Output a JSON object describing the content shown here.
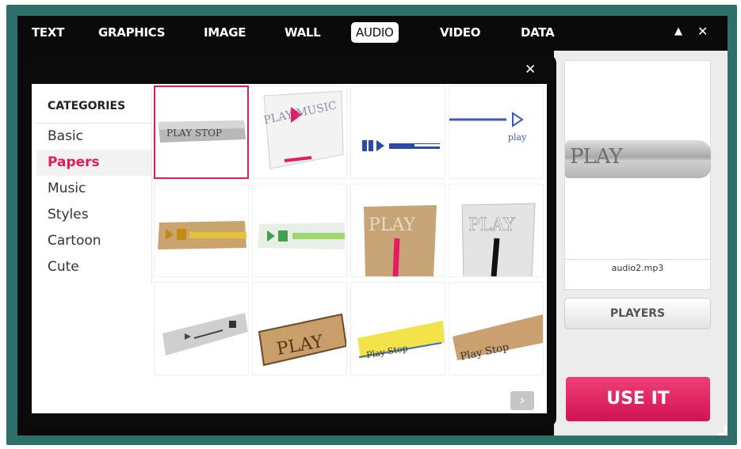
{
  "tabs": [
    {
      "label": "TEXT",
      "active": false
    },
    {
      "label": "GRAPHICS",
      "active": false
    },
    {
      "label": "IMAGE",
      "active": false
    },
    {
      "label": "WALL",
      "active": false
    },
    {
      "label": "AUDIO",
      "active": true
    },
    {
      "label": "VIDEO",
      "active": false
    },
    {
      "label": "DATA",
      "active": false
    }
  ],
  "window_controls": {
    "collapse": "▲",
    "close": "✕"
  },
  "dialog": {
    "close": "✕"
  },
  "categories": {
    "header": "CATEGORIES",
    "items": [
      {
        "label": "Basic",
        "active": false
      },
      {
        "label": "Papers",
        "active": true
      },
      {
        "label": "Music",
        "active": false
      },
      {
        "label": "Styles",
        "active": false
      },
      {
        "label": "Cartoon",
        "active": false
      },
      {
        "label": "Cute",
        "active": false
      }
    ]
  },
  "players_grid": {
    "tiles": [
      {
        "label": "PLAY STOP",
        "selected": true
      },
      {
        "label": "PLAY MUSIC",
        "selected": false
      },
      {
        "label": "",
        "selected": false
      },
      {
        "label": "play",
        "selected": false
      },
      {
        "label": "",
        "selected": false
      },
      {
        "label": "",
        "selected": false
      },
      {
        "label": "PLAY",
        "selected": false
      },
      {
        "label": "PLAY",
        "selected": false
      },
      {
        "label": "",
        "selected": false
      },
      {
        "label": "PLAY",
        "selected": false
      },
      {
        "label": "Play Stop",
        "selected": false
      },
      {
        "label": "Play Stop",
        "selected": false
      }
    ],
    "next": "›"
  },
  "preview": {
    "art_label": "PLAY",
    "filename": "audio2.mp3"
  },
  "buttons": {
    "players": "PLAYERS",
    "use_it": "USE IT"
  },
  "colors": {
    "accent": "#e21c62",
    "frame": "#2f6f6a",
    "window": "#0a0a0a"
  }
}
